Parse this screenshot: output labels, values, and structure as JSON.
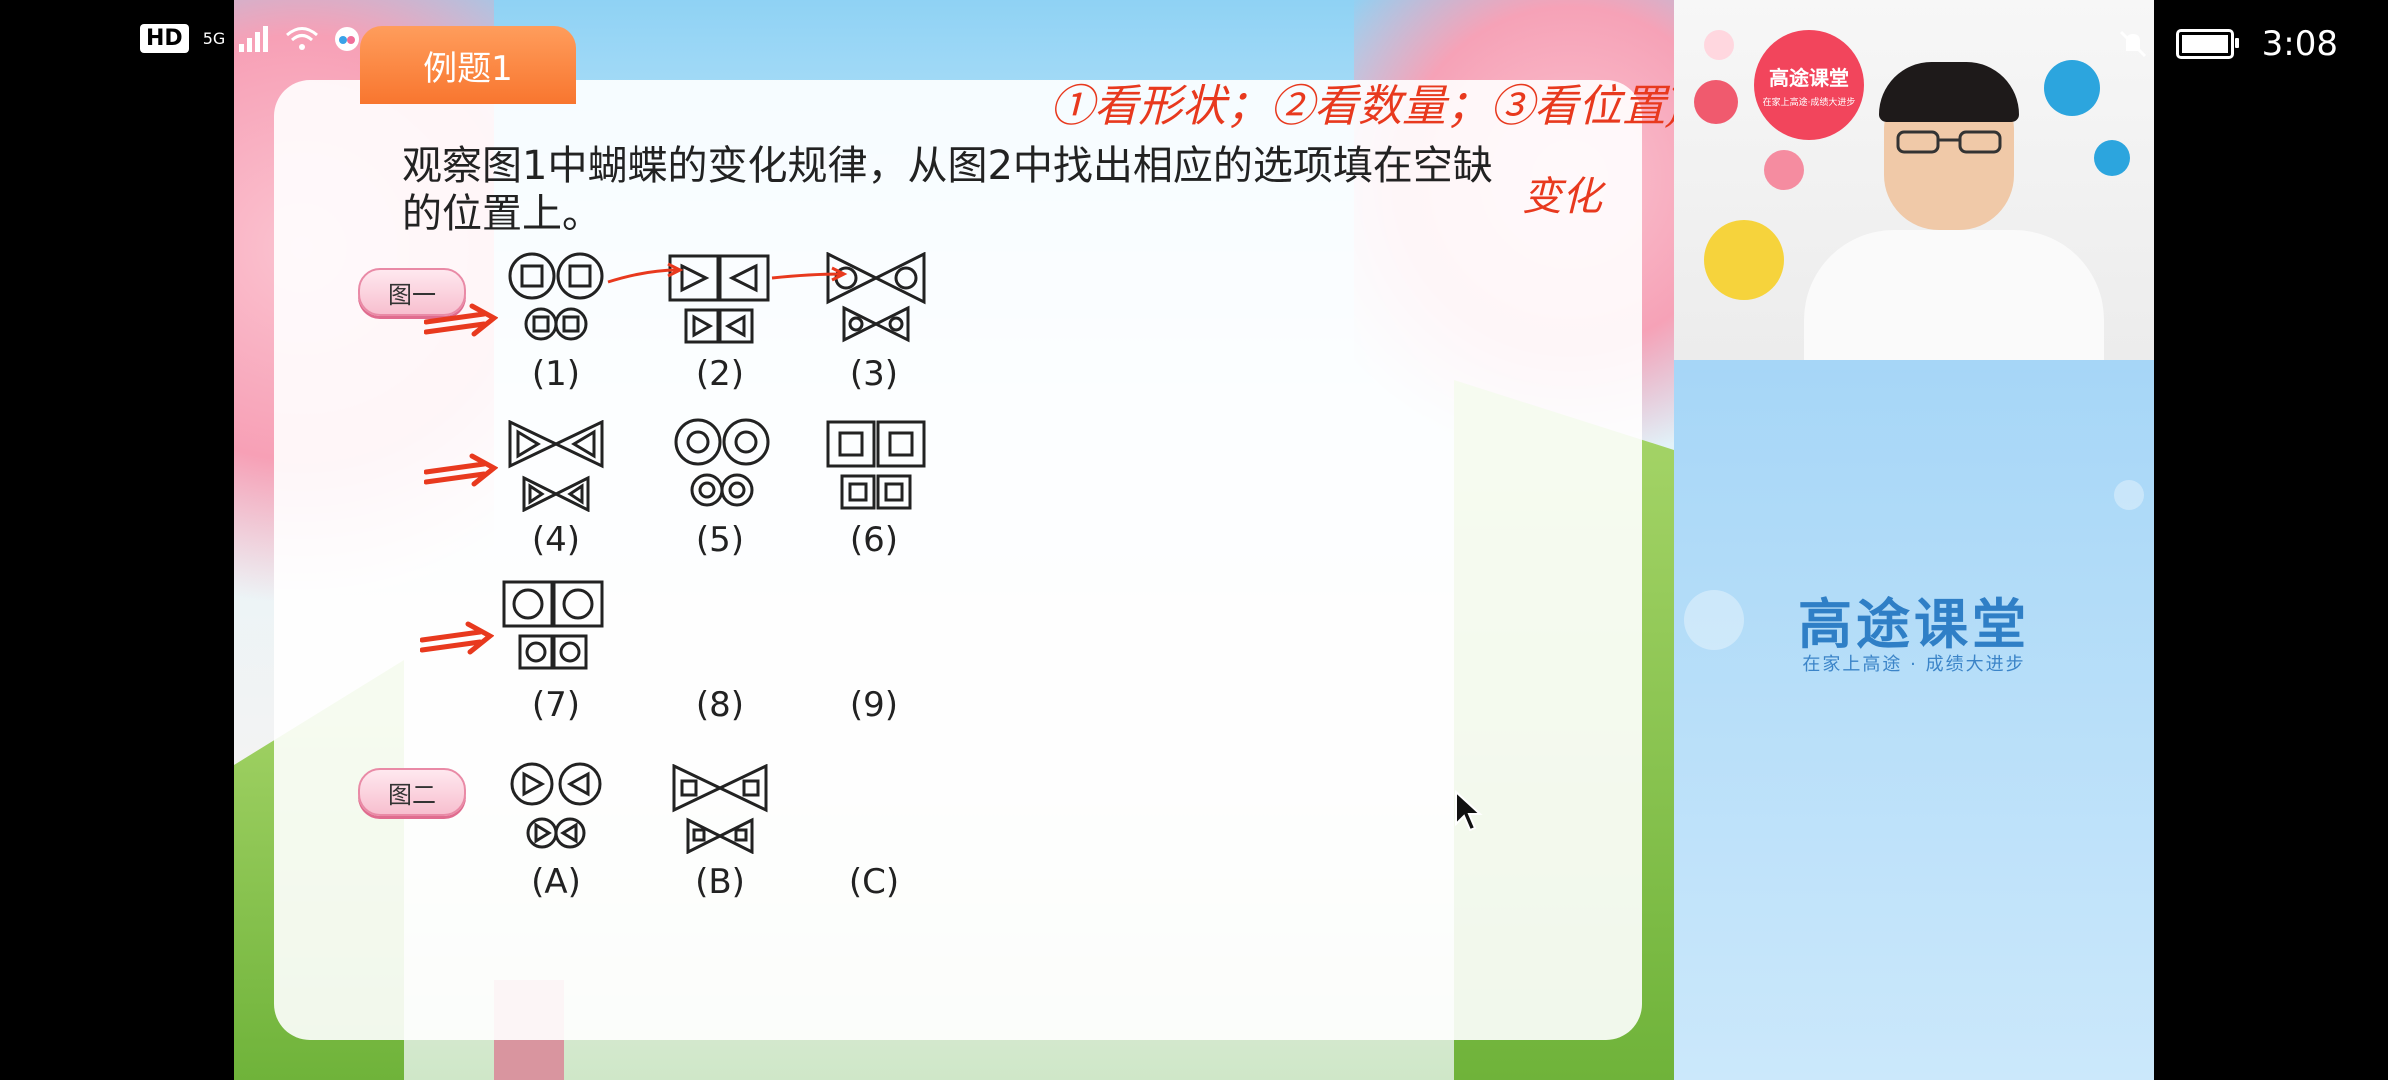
{
  "status_bar": {
    "hd": "HD",
    "network": "5G",
    "signal_bars": "4 bars",
    "time": "3:08"
  },
  "slide": {
    "tab_label": "例题1",
    "question": "观察图1中蝴蝶的变化规律，从图2中找出相应的选项填在空缺的位置上。",
    "handwritten_note": "①看形状；②看数量；③看位置)",
    "handwritten_note_2": "变化",
    "figure1_label": "图一",
    "figure2_label": "图二",
    "grid_labels": [
      "(1)",
      "(2)",
      "(3)",
      "(4)",
      "(5)",
      "(6)",
      "(7)",
      "(8)",
      "(9)"
    ],
    "option_labels": [
      "(A)",
      "(B)",
      "(C)"
    ]
  },
  "video": {
    "logo_text": "高途课堂",
    "logo_sub": "在家上高途·成绩大进步"
  },
  "brand_panel": {
    "title": "高途课堂",
    "subtitle": "在家上高途 · 成绩大进步"
  },
  "colors": {
    "accent_orange": "#f8762f",
    "annotation_red": "#e8391e",
    "brand_blue": "#2f7fc6",
    "pill_pink": "#f7bfcf"
  }
}
